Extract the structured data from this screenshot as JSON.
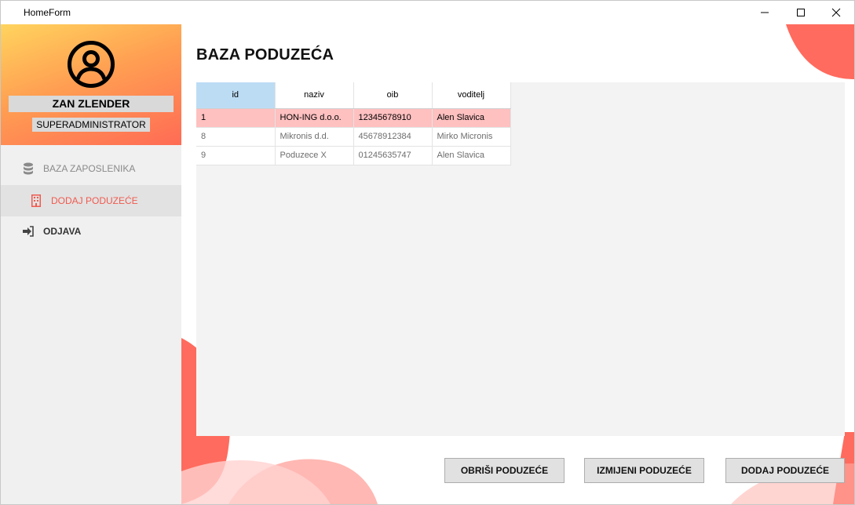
{
  "window": {
    "title": "HomeForm",
    "controls": [
      "minimize-icon",
      "maximize-icon",
      "close-icon"
    ]
  },
  "sidebar": {
    "user": {
      "icon": "user-circle-icon",
      "name": "ZAN ZLENDER",
      "role": "SUPERADMINISTRATOR"
    },
    "items": [
      {
        "label": "BAZA ZAPOSLENIKA",
        "icon": "database-icon",
        "active": false
      },
      {
        "label": "DODAJ PODUZEĆE",
        "icon": "building-icon",
        "active": true
      },
      {
        "label": "ODJAVA",
        "icon": "sign-out-icon",
        "active": false
      }
    ]
  },
  "main": {
    "title": "BAZA PODUZEĆA",
    "table": {
      "columns": [
        "id",
        "naziv",
        "oib",
        "voditelj"
      ],
      "rows": [
        {
          "id": "1",
          "naziv": "HON-ING d.o.o.",
          "oib": "12345678910",
          "voditelj": "Alen Slavica",
          "highlighted": true
        },
        {
          "id": "8",
          "naziv": "Mikronis d.d.",
          "oib": "45678912384",
          "voditelj": "Mirko Micronis",
          "highlighted": false
        },
        {
          "id": "9",
          "naziv": "Poduzece X",
          "oib": "01245635747",
          "voditelj": "Alen Slavica",
          "highlighted": false
        }
      ]
    },
    "buttons": {
      "delete": "OBRIŠI PODUZEĆE",
      "edit": "IZMIJENI PODUZEĆE",
      "add": "DODAJ PODUZEĆE"
    }
  },
  "colors": {
    "accent": "#f05a4f",
    "highlight_row": "#ffc0c0",
    "selected_header": "#bcdcf4",
    "gradient_top": "#ffd45e",
    "gradient_bottom": "#ff6b55"
  }
}
